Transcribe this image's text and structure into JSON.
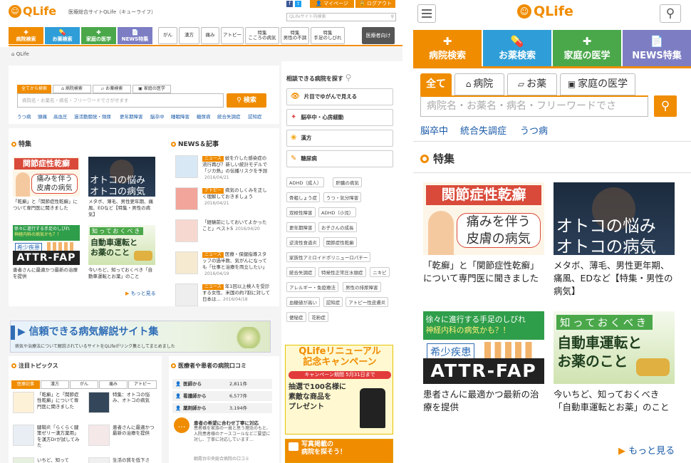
{
  "desktop": {
    "logo": "QLife",
    "tagline": "医療総合サイトQLife（キューライフ）",
    "header_links": [
      "マイページ",
      "ログアウト"
    ],
    "search_placeholder": "QLifeサイト内検索",
    "cat_buttons": [
      {
        "label": "病院検索",
        "color": "#f08c00"
      },
      {
        "label": "お薬検索",
        "color": "#2f9ed8"
      },
      {
        "label": "家庭の医学",
        "color": "#4aa84a"
      },
      {
        "label": "NEWS特集",
        "color": "#7d7dc4"
      }
    ],
    "disease_tabs": [
      "がん",
      "漢方",
      "痛み",
      "アトピー",
      "特集\nこころの病気",
      "特集\n男性の不調",
      "特集\n手足のしびれ"
    ],
    "pro_button": "医療者向け",
    "breadcrumb": "QLife",
    "search_tabs": [
      "全てから検索",
      "病院検索",
      "お薬検索",
      "家庭の医学"
    ],
    "search_input_placeholder": "病院名・お薬名・病名・フリーワードでさがせます",
    "search_button": "検索",
    "quick_links": [
      "うつ病",
      "頭痛",
      "高血圧",
      "過活動膀胱・頻尿",
      "更年期障害",
      "脳卒中",
      "睡眠障害",
      "糖尿病",
      "統合失調症",
      "認知症"
    ],
    "feature_heading": "特集",
    "features": [
      {
        "img_lines": [
          "関節症性乾癬",
          "痛みを伴う",
          "皮膚の病気"
        ],
        "caption": "「乾癬」と「関節症性乾癬」について専門医に聞きました"
      },
      {
        "img_lines": [
          "オトコの悩み",
          "オトコの病気"
        ],
        "caption": "メタボ、薄毛、男性更年期、痛風、EDなど【特集・男性の病気】"
      },
      {
        "img_lines": [
          "徐々に進行する手足のしびれ",
          "神経内科の病気かも？！",
          "希少疾患",
          "ATTR-FAP"
        ],
        "caption": "患者さんに最適かつ最新の治療を提供"
      },
      {
        "img_lines": [
          "知っておくべき",
          "自動車運転と",
          "お薬のこと"
        ],
        "caption": "今いちど、知っておくべき「自動車運転とお薬」のこと"
      }
    ],
    "more_link": "もっと見る",
    "news_heading": "NEWS＆記事",
    "news": [
      {
        "badge": "ニュース",
        "text": "蚊を介した感染症の流行再び？新しい統計モデルで「ジカ熱」の伝播リスクを予測",
        "date": "2016/04/21"
      },
      {
        "badge": "アトピー",
        "text": "病気のしくみを正しく理解しておきましょう",
        "date": "2016/04/21"
      },
      {
        "badge": "",
        "text": "「経験前にしておいてよかったこと」ベスト5",
        "date": "2016/04/20"
      },
      {
        "badge": "ニュース",
        "text": "医療・保健指導スタッフの過半数、気がんになっても「仕事と治療を両立したい」",
        "date": "2016/04/19"
      },
      {
        "badge": "ニュース",
        "text": "年1回以上検人を受診する女性、米国の約7割に対して日本は…",
        "date": "2016/04/18"
      }
    ],
    "banner_title": "信頼できる病気解説サイト集",
    "banner_sub": "病気や治療法について解説されているサイトをQLifeがリンク集としてまとめました",
    "topics_heading": "注目トピックス",
    "topics_tabs": [
      "医療記事",
      "漢方",
      "がん",
      "痛み",
      "アトピー"
    ],
    "topics": [
      {
        "text": "「乾癬」と「関節症性乾癬」について専門医に聞きました"
      },
      {
        "text": "特集：オトコの悩み、オトコの病気"
      },
      {
        "text": "腱鞘炎「らくらく腱策ゼリー漢方薬用」を漢方Drが試してみた"
      },
      {
        "text": "患者さんに最適かつ最新の治療を提供"
      },
      {
        "text": "いちど、知って"
      },
      {
        "text": "生活の質を低下さ"
      }
    ],
    "reviews_heading": "医療者や患者の病院口コミ",
    "reviews": [
      {
        "label": "医師から",
        "count": "2,811件"
      },
      {
        "label": "看護師から",
        "count": "6,577件"
      },
      {
        "label": "薬剤師から",
        "count": "3,194件"
      }
    ],
    "review_quote_title": "患者の希望に合わせ丁寧に対応",
    "review_quote_text": "患者様を家族の一員と思う理念のもと、入院患者様のナースコールなどご要望に対し、丁寧に対応しています…",
    "review_quote_src": "朝霞台中央総合病院の口コミ",
    "sidebar_heading": "相談できる病院を探す",
    "sidebar_items": [
      {
        "label": "片目でゆがんで見える",
        "color": "#f08c00"
      },
      {
        "label": "脳卒中・心房細動",
        "color": "#e05050"
      },
      {
        "label": "漢方",
        "color": "#f0a000"
      },
      {
        "label": "糖尿病",
        "color": "#f08c00"
      }
    ],
    "sidebar_tags": [
      "ADHD（成人）",
      "肝臓の病気",
      "骨粗しょう症",
      "うつ・気分障害",
      "双極性障害",
      "ADHD（小児）",
      "更年期障害",
      "お子さんの成長",
      "逆流性食道炎",
      "関節症性乾癬",
      "家族性アミロイドポリニューロパチー",
      "統合失調症",
      "特発性正常圧水頭症",
      "ニキビ",
      "アレルギー・免疫療法",
      "男性の排尿障害",
      "血糖値が高い",
      "認知症",
      "アトピー性皮膚炎",
      "便秘症",
      "花粉症"
    ],
    "campaign_title": "QLifeリニューアル\n記念キャンペーン",
    "campaign_period": "キャンペーン期間 5月31日まで",
    "campaign_body": "抽選で100名様に\n素敵な商品を\nプレゼント",
    "photo_banner": "写真掲載の\n病院を探そう！"
  },
  "mobile": {
    "logo": "QLife",
    "cat_buttons": [
      {
        "label": "病院検索",
        "color": "#f08c00"
      },
      {
        "label": "お薬検索",
        "color": "#2f9ed8"
      },
      {
        "label": "家庭の医学",
        "color": "#4aa84a"
      },
      {
        "label": "NEWS特集",
        "color": "#7d7dc4"
      }
    ],
    "search_tabs": [
      "全て",
      "病院",
      "お薬",
      "家庭の医学"
    ],
    "search_placeholder": "病院名・お薬名・病名・フリーワードでさ",
    "quick_links": [
      "脳卒中",
      "統合失調症",
      "うつ病"
    ],
    "feature_heading": "特集",
    "features": [
      {
        "img_lines": [
          "関節症性乾癬",
          "痛みを伴う",
          "皮膚の病気"
        ],
        "caption": "「乾癬」と「関節症性乾癬」について専門医に聞きました"
      },
      {
        "img_lines": [
          "オトコの悩み",
          "オトコの病気"
        ],
        "caption": "メタボ、薄毛、男性更年期、痛風、EDなど【特集・男性の病気】"
      },
      {
        "img_lines": [
          "徐々に進行する手足のしびれ",
          "神経内科の病気かも？！",
          "希少疾患",
          "ATTR-FAP"
        ],
        "caption": "患者さんに最適かつ最新の治療を提供"
      },
      {
        "img_lines": [
          "知っておくべき",
          "自動車運転と",
          "お薬のこと"
        ],
        "caption": "今いちど、知っておくべき「自動車運転とお薬」のこと"
      }
    ],
    "more_link": "もっと見る"
  }
}
